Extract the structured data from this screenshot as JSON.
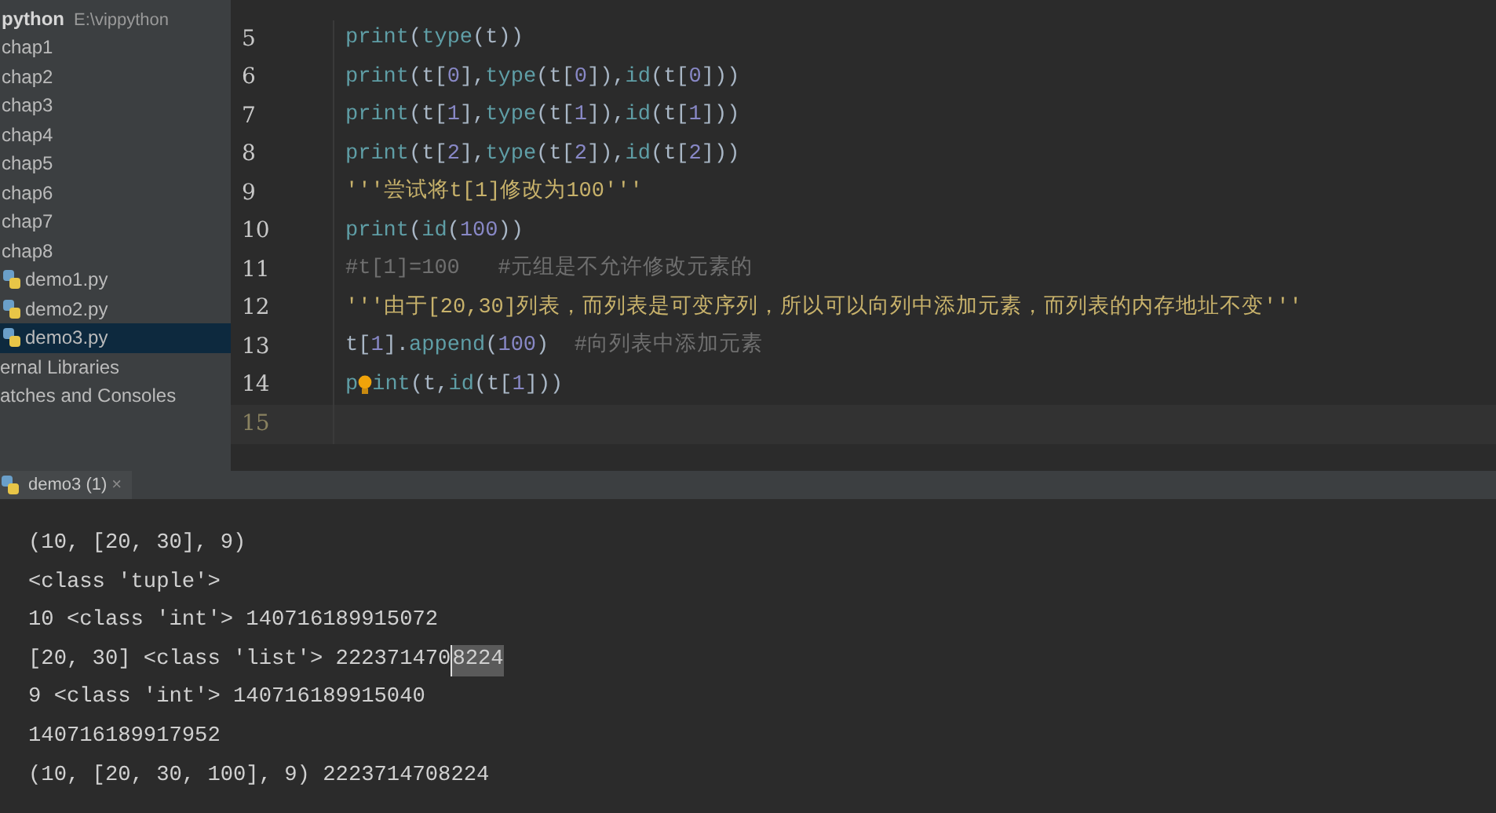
{
  "project": {
    "name": "python",
    "path": "E:\\vippython"
  },
  "sidebar": {
    "items": [
      {
        "kind": "folder",
        "label": "chap1",
        "selected": false
      },
      {
        "kind": "folder",
        "label": "chap2",
        "selected": false
      },
      {
        "kind": "folder",
        "label": "chap3",
        "selected": false
      },
      {
        "kind": "folder",
        "label": "chap4",
        "selected": false
      },
      {
        "kind": "folder",
        "label": "chap5",
        "selected": false
      },
      {
        "kind": "folder",
        "label": "chap6",
        "selected": false
      },
      {
        "kind": "folder",
        "label": "chap7",
        "selected": false
      },
      {
        "kind": "folder",
        "label": "chap8",
        "selected": false
      },
      {
        "kind": "file",
        "label": "demo1.py",
        "selected": false
      },
      {
        "kind": "file",
        "label": "demo2.py",
        "selected": false
      },
      {
        "kind": "file",
        "label": "demo3.py",
        "selected": true
      },
      {
        "kind": "group",
        "label": "ernal Libraries",
        "selected": false
      },
      {
        "kind": "group",
        "label": "atches and Consoles",
        "selected": false
      }
    ]
  },
  "editor": {
    "lines": [
      {
        "number": "5",
        "current": false,
        "tokens": [
          {
            "kind": "builtin",
            "text": "print"
          },
          {
            "kind": "plain",
            "text": "("
          },
          {
            "kind": "builtin",
            "text": "type"
          },
          {
            "kind": "plain",
            "text": "(t))"
          }
        ]
      },
      {
        "number": "6",
        "current": false,
        "tokens": [
          {
            "kind": "builtin",
            "text": "print"
          },
          {
            "kind": "plain",
            "text": "(t["
          },
          {
            "kind": "number",
            "text": "0"
          },
          {
            "kind": "plain",
            "text": "],"
          },
          {
            "kind": "builtin",
            "text": "type"
          },
          {
            "kind": "plain",
            "text": "(t["
          },
          {
            "kind": "number",
            "text": "0"
          },
          {
            "kind": "plain",
            "text": "]),"
          },
          {
            "kind": "builtin",
            "text": "id"
          },
          {
            "kind": "plain",
            "text": "(t["
          },
          {
            "kind": "number",
            "text": "0"
          },
          {
            "kind": "plain",
            "text": "]))"
          }
        ]
      },
      {
        "number": "7",
        "current": false,
        "tokens": [
          {
            "kind": "builtin",
            "text": "print"
          },
          {
            "kind": "plain",
            "text": "(t["
          },
          {
            "kind": "number",
            "text": "1"
          },
          {
            "kind": "plain",
            "text": "],"
          },
          {
            "kind": "builtin",
            "text": "type"
          },
          {
            "kind": "plain",
            "text": "(t["
          },
          {
            "kind": "number",
            "text": "1"
          },
          {
            "kind": "plain",
            "text": "]),"
          },
          {
            "kind": "builtin",
            "text": "id"
          },
          {
            "kind": "plain",
            "text": "(t["
          },
          {
            "kind": "number",
            "text": "1"
          },
          {
            "kind": "plain",
            "text": "]))"
          }
        ]
      },
      {
        "number": "8",
        "current": false,
        "tokens": [
          {
            "kind": "builtin",
            "text": "print"
          },
          {
            "kind": "plain",
            "text": "(t["
          },
          {
            "kind": "number",
            "text": "2"
          },
          {
            "kind": "plain",
            "text": "],"
          },
          {
            "kind": "builtin",
            "text": "type"
          },
          {
            "kind": "plain",
            "text": "(t["
          },
          {
            "kind": "number",
            "text": "2"
          },
          {
            "kind": "plain",
            "text": "]),"
          },
          {
            "kind": "builtin",
            "text": "id"
          },
          {
            "kind": "plain",
            "text": "(t["
          },
          {
            "kind": "number",
            "text": "2"
          },
          {
            "kind": "plain",
            "text": "]))"
          }
        ]
      },
      {
        "number": "9",
        "current": false,
        "tokens": [
          {
            "kind": "string",
            "text": "'''尝试将t[1]修改为100'''"
          }
        ]
      },
      {
        "number": "10",
        "current": false,
        "tokens": [
          {
            "kind": "builtin",
            "text": "print"
          },
          {
            "kind": "plain",
            "text": "("
          },
          {
            "kind": "builtin",
            "text": "id"
          },
          {
            "kind": "plain",
            "text": "("
          },
          {
            "kind": "number",
            "text": "100"
          },
          {
            "kind": "plain",
            "text": "))"
          }
        ]
      },
      {
        "number": "11",
        "current": false,
        "tokens": [
          {
            "kind": "comment",
            "text": "#t[1]=100   #元组是不允许修改元素的"
          }
        ]
      },
      {
        "number": "12",
        "current": false,
        "tokens": [
          {
            "kind": "string",
            "text": "'''由于[20,30]列表，而列表是可变序列，所以可以向列中添加元素，而列表的内存地址不变'''"
          }
        ]
      },
      {
        "number": "13",
        "current": false,
        "tokens": [
          {
            "kind": "plain",
            "text": "t["
          },
          {
            "kind": "number",
            "text": "1"
          },
          {
            "kind": "plain",
            "text": "]."
          },
          {
            "kind": "builtin",
            "text": "append"
          },
          {
            "kind": "plain",
            "text": "("
          },
          {
            "kind": "number",
            "text": "100"
          },
          {
            "kind": "plain",
            "text": ")"
          },
          {
            "kind": "comment",
            "text": "  #向列表中添加元素"
          }
        ]
      },
      {
        "number": "14",
        "current": false,
        "tokens": [
          {
            "kind": "builtin",
            "text": "p"
          },
          {
            "kind": "bulb"
          },
          {
            "kind": "builtin",
            "text": "int"
          },
          {
            "kind": "plain",
            "text": "(t,"
          },
          {
            "kind": "builtin",
            "text": "id"
          },
          {
            "kind": "plain",
            "text": "(t["
          },
          {
            "kind": "number",
            "text": "1"
          },
          {
            "kind": "plain",
            "text": "]))"
          }
        ]
      },
      {
        "number": "15",
        "current": true
      }
    ]
  },
  "console": {
    "tab": {
      "label": "demo3 (1)",
      "close": "×"
    },
    "lines": [
      [
        {
          "text": "(10, [20, 30], 9)",
          "highlighted": false
        }
      ],
      [
        {
          "text": "<class 'tuple'>",
          "highlighted": false
        }
      ],
      [
        {
          "text": "10 <class 'int'> 140716189915072",
          "highlighted": false
        }
      ],
      [
        {
          "text": "[20, 30] <class 'list'> 222371470",
          "highlighted": false
        },
        {
          "text": "8224",
          "highlighted": true
        }
      ],
      [
        {
          "text": "9 <class 'int'> 140716189915040",
          "highlighted": false
        }
      ],
      [
        {
          "text": "140716189917952",
          "highlighted": false
        }
      ],
      [
        {
          "text": "(10, [20, 30, 100], 9) 2223714708224",
          "highlighted": false
        }
      ]
    ]
  }
}
